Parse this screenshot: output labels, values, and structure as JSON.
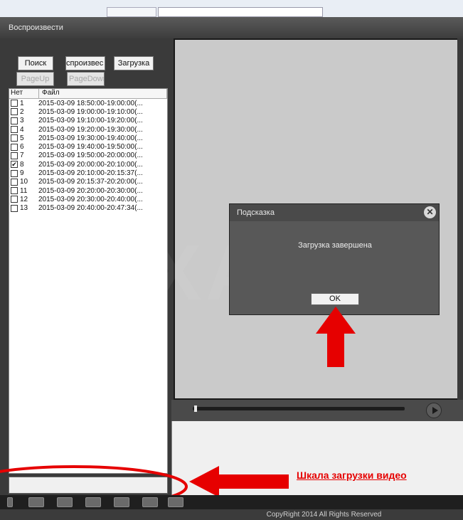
{
  "window": {
    "title": "Воспроизвести"
  },
  "toolbar": {
    "search": "Поиск",
    "play": "спроизвес",
    "download": "Загрузка",
    "page_up": "PageUp",
    "page_down": "PageDown"
  },
  "file_list": {
    "columns": [
      "Нет",
      "Файл"
    ],
    "rows": [
      {
        "no": "1",
        "file": "2015-03-09 18:50:00-19:00:00(...",
        "checked": false
      },
      {
        "no": "2",
        "file": "2015-03-09 19:00:00-19:10:00(...",
        "checked": false
      },
      {
        "no": "3",
        "file": "2015-03-09 19:10:00-19:20:00(...",
        "checked": false
      },
      {
        "no": "4",
        "file": "2015-03-09 19:20:00-19:30:00(...",
        "checked": false
      },
      {
        "no": "5",
        "file": "2015-03-09 19:30:00-19:40:00(...",
        "checked": false
      },
      {
        "no": "6",
        "file": "2015-03-09 19:40:00-19:50:00(...",
        "checked": false
      },
      {
        "no": "7",
        "file": "2015-03-09 19:50:00-20:00:00(...",
        "checked": false
      },
      {
        "no": "8",
        "file": "2015-03-09 20:00:00-20:10:00(...",
        "checked": true
      },
      {
        "no": "9",
        "file": "2015-03-09 20:10:00-20:15:37(...",
        "checked": false
      },
      {
        "no": "10",
        "file": "2015-03-09 20:15:37-20:20:00(...",
        "checked": false
      },
      {
        "no": "11",
        "file": "2015-03-09 20:20:00-20:30:00(...",
        "checked": false
      },
      {
        "no": "12",
        "file": "2015-03-09 20:30:00-20:40:00(...",
        "checked": false
      },
      {
        "no": "13",
        "file": "2015-03-09 20:40:00-20:47:34(...",
        "checked": false
      }
    ]
  },
  "dialog": {
    "title": "Подсказка",
    "message": "Загрузка завершена",
    "ok": "OK"
  },
  "annotation": {
    "label": "Шкала загрузки видео",
    "color": "#e60000"
  },
  "watermark": "REXANT",
  "footer": "CopyRight 2014 All Rights Reserved",
  "playback": {
    "progress": 0.0
  },
  "icons": [
    "close-icon",
    "play-icon",
    "toolbar-icon"
  ]
}
